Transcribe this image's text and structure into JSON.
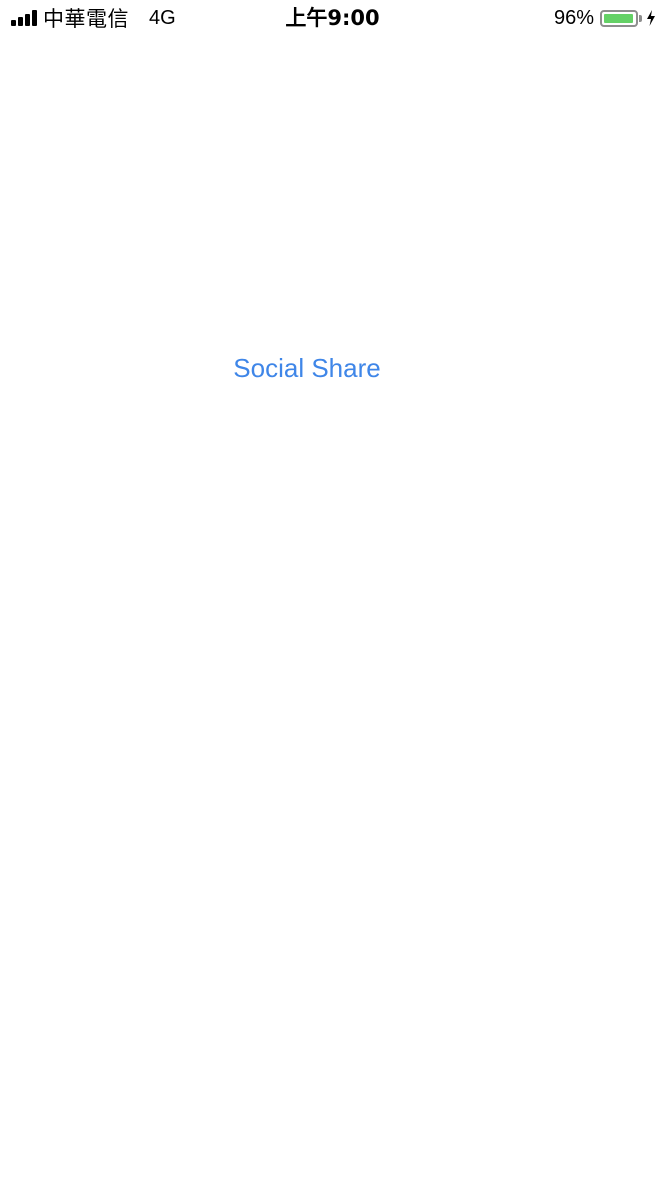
{
  "status_bar": {
    "signal_icon": "signal-bars-icon",
    "carrier": "中華電信",
    "network": "4G",
    "time": "上午9:00",
    "battery_percent": "96%",
    "battery_level": 0.96,
    "battery_icon": "battery-icon",
    "charging_icon": "charging-bolt-icon",
    "battery_color": "#64d166"
  },
  "main": {
    "share_label": "Social Share",
    "accent_color": "#3f86e8"
  }
}
